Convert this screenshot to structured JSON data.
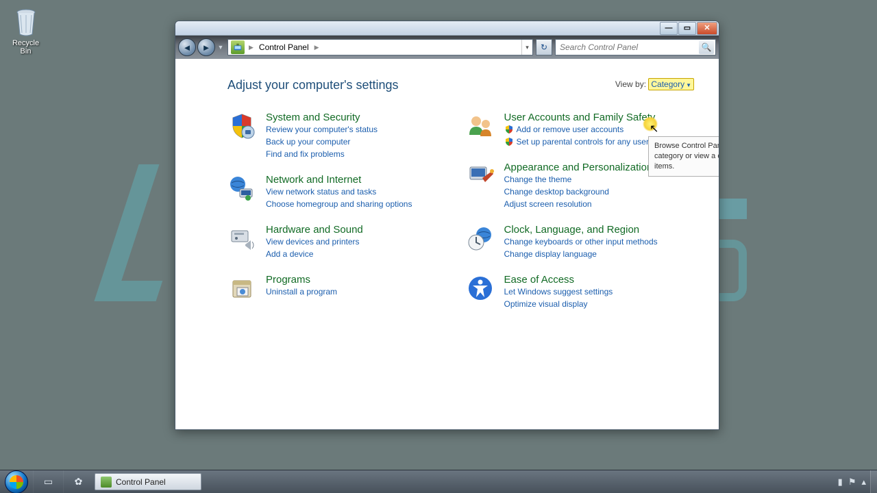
{
  "desktop": {
    "recycle_label": "Recycle Bin"
  },
  "window": {
    "addr_segment": "Control Panel",
    "search_placeholder": "Search Control Panel"
  },
  "heading": "Adjust your computer's settings",
  "viewby": {
    "label": "View by:",
    "value": "Category"
  },
  "tooltip": "Browse Control Panel items by category or view a complete list of all items.",
  "left": [
    {
      "title": "System and Security",
      "links": [
        "Review your computer's status",
        "Back up your computer",
        "Find and fix problems"
      ]
    },
    {
      "title": "Network and Internet",
      "links": [
        "View network status and tasks",
        "Choose homegroup and sharing options"
      ]
    },
    {
      "title": "Hardware and Sound",
      "links": [
        "View devices and printers",
        "Add a device"
      ]
    },
    {
      "title": "Programs",
      "links": [
        "Uninstall a program"
      ]
    }
  ],
  "right": [
    {
      "title": "User Accounts and Family Safety",
      "links": [
        "Add or remove user accounts",
        "Set up parental controls for any user"
      ],
      "shielded": [
        0,
        1
      ]
    },
    {
      "title": "Appearance and Personalization",
      "links": [
        "Change the theme",
        "Change desktop background",
        "Adjust screen resolution"
      ]
    },
    {
      "title": "Clock, Language, and Region",
      "links": [
        "Change keyboards or other input methods",
        "Change display language"
      ]
    },
    {
      "title": "Ease of Access",
      "links": [
        "Let Windows suggest settings",
        "Optimize visual display"
      ]
    }
  ],
  "taskbar": {
    "task_label": "Control Panel"
  }
}
